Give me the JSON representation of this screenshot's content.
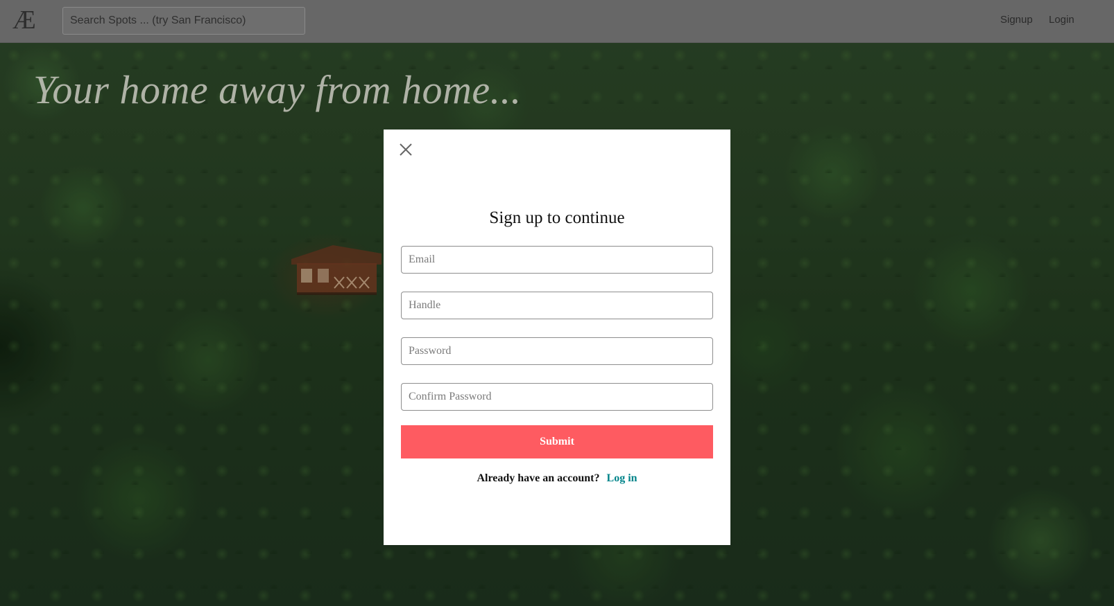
{
  "navbar": {
    "logo_text": "Æ",
    "search_placeholder": "Search Spots ... (try San Francisco)",
    "signup_label": "Signup",
    "login_label": "Login"
  },
  "hero": {
    "tagline": "Your home away from home..."
  },
  "signup_modal": {
    "title": "Sign up to continue",
    "email_placeholder": "Email",
    "handle_placeholder": "Handle",
    "password_placeholder": "Password",
    "confirm_password_placeholder": "Confirm Password",
    "submit_label": "Submit",
    "switch_prompt": "Already have an account?",
    "switch_link_label": "Log in"
  },
  "colors": {
    "navbar_bg": "#676767",
    "submit_bg": "#fe5b61",
    "link_color": "#00848a"
  },
  "icons": {
    "close": "close-icon"
  }
}
